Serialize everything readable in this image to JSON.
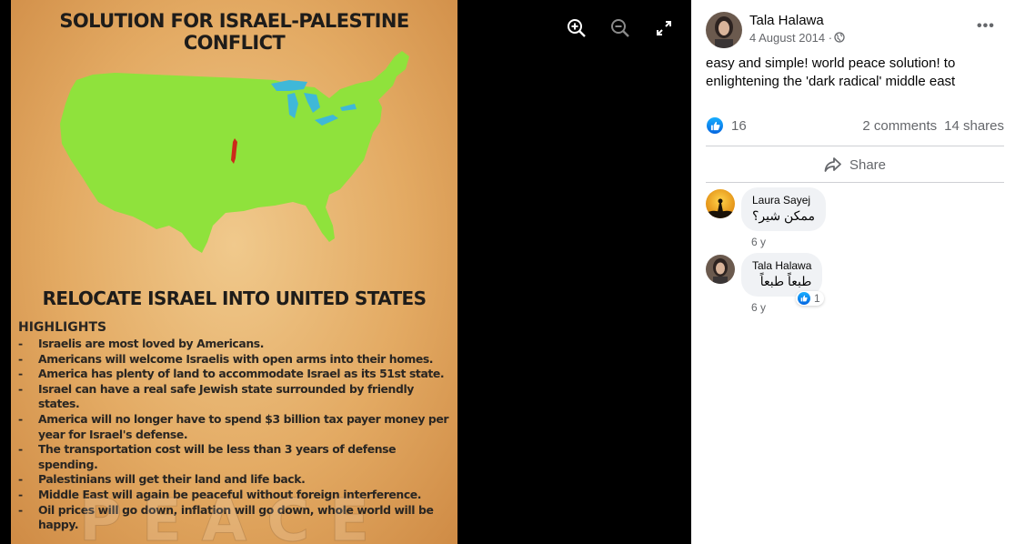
{
  "viewer": {
    "controls": [
      {
        "icon": "zoom-in-icon"
      },
      {
        "icon": "zoom-out-icon"
      },
      {
        "icon": "fullscreen-icon"
      }
    ],
    "poster": {
      "title": "SOLUTION FOR ISRAEL-PALESTINE CONFLICT",
      "subtitle": "RELOCATE ISRAEL INTO UNITED STATES",
      "highlights_title": "HIGHLIGHTS",
      "highlights": [
        "Israelis are most loved by Americans.",
        "Americans will welcome Israelis with open arms into their homes.",
        "America has plenty of land to accommodate Israel as its 51st state.",
        "Israel can have a real safe Jewish state surrounded by friendly states.",
        "America will no longer have to spend $3 billion tax payer money per year for Israel's defense.",
        "The transportation cost will be less than 3 years of defense spending.",
        "Palestinians will get their land and life back.",
        "Middle East will again be peaceful without foreign interference.",
        "Oil prices will go down, inflation will go down, whole world will be happy."
      ],
      "watermark": "PEACE",
      "colors": {
        "map_green": "#8fe23c",
        "israel_red": "#cc2a1a",
        "lakes_blue": "#3fb8d8"
      }
    }
  },
  "post": {
    "author": "Tala Halawa",
    "date": "4 August 2014 ·",
    "privacy_icon": "globe-icon",
    "more_label": "•••",
    "text": "easy and simple! world peace solution! to enlightening the 'dark radical' middle east",
    "reaction_count": "16",
    "comments_count": "2 comments",
    "shares_count": "14 shares",
    "share_label": "Share"
  },
  "comments": [
    {
      "author": "Laura Sayej",
      "text": "ممكن شير؟",
      "time": "6 y"
    },
    {
      "author": "Tala Halawa",
      "text": "طبعاً طبعاً",
      "time": "6 y",
      "reactions": "1"
    }
  ],
  "colors": {
    "accent": "#1877f2",
    "secondary_text": "#65676b",
    "bubble": "#f0f2f5"
  }
}
